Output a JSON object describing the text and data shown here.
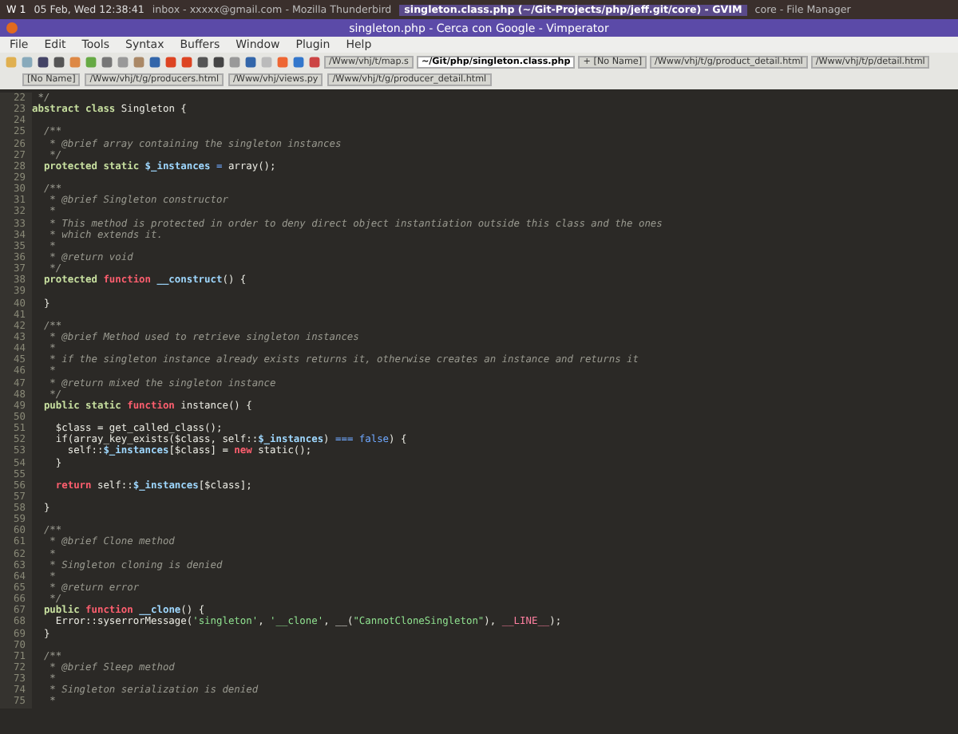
{
  "panel": {
    "workspace": "W 1",
    "clock": "05 Feb, Wed 12:38:41",
    "tasks": [
      {
        "label": "inbox - xxxxx@gmail.com - Mozilla Thunderbird",
        "selected": false
      },
      {
        "label": "singleton.class.php (~/Git-Projects/php/jeff.git/core) - GVIM",
        "selected": true
      },
      {
        "label": "core - File Manager",
        "selected": false
      }
    ]
  },
  "window": {
    "title": "singleton.php - Cerca con Google - Vimperator"
  },
  "menu": [
    "File",
    "Edit",
    "Tools",
    "Syntax",
    "Buffers",
    "Window",
    "Plugin",
    "Help"
  ],
  "buffers_top": [
    {
      "label": "/Www/vhj/t/map.s",
      "selected": false
    },
    {
      "label": "~/Git/php/singleton.class.php",
      "selected": true
    },
    {
      "label": "+ [No Name]",
      "selected": false
    },
    {
      "label": "/Www/vhj/t/g/product_detail.html",
      "selected": false
    },
    {
      "label": "/Www/vhj/t/p/detail.html",
      "selected": false
    }
  ],
  "buffers": [
    {
      "label": "[No Name]",
      "selected": false
    },
    {
      "label": "/Www/vhj/t/g/producers.html",
      "selected": false
    },
    {
      "label": "/Www/vhj/views.py",
      "selected": false
    },
    {
      "label": "/Www/vhj/t/g/producer_detail.html",
      "selected": false
    }
  ],
  "code": [
    {
      "number": "22",
      "tokens": [
        {
          "kind": "comment",
          "text": " */"
        }
      ]
    },
    {
      "number": "23",
      "tokens": [
        {
          "kind": "keyword",
          "text": "abstract class "
        },
        {
          "kind": "plain",
          "text": "Singleton {"
        }
      ]
    },
    {
      "number": "24"
    },
    {
      "number": "25",
      "tokens": [
        {
          "kind": "comment",
          "text": "  /**"
        }
      ]
    },
    {
      "number": "26",
      "tokens": [
        {
          "kind": "comment",
          "text": "   * @brief array containing the singleton instances"
        }
      ]
    },
    {
      "number": "27",
      "tokens": [
        {
          "kind": "comment",
          "text": "   */"
        }
      ]
    },
    {
      "number": "28",
      "tokens": [
        {
          "kind": "keyword",
          "text": "  protected static "
        },
        {
          "kind": "variable",
          "text": "$_instances"
        },
        {
          "kind": "operator",
          "text": " = "
        },
        {
          "kind": "plain",
          "text": "array();"
        }
      ]
    },
    {
      "number": "29"
    },
    {
      "number": "30",
      "tokens": [
        {
          "kind": "comment",
          "text": "  /**"
        }
      ]
    },
    {
      "number": "31",
      "tokens": [
        {
          "kind": "comment",
          "text": "   * @brief Singleton constructor"
        }
      ]
    },
    {
      "number": "32",
      "tokens": [
        {
          "kind": "comment",
          "text": "   *"
        }
      ]
    },
    {
      "number": "33",
      "tokens": [
        {
          "kind": "comment",
          "text": "   * This method is protected in order to deny direct object instantiation outside this class and the ones"
        }
      ]
    },
    {
      "number": "34",
      "tokens": [
        {
          "kind": "comment",
          "text": "   * which extends it."
        }
      ]
    },
    {
      "number": "35",
      "tokens": [
        {
          "kind": "comment",
          "text": "   *"
        }
      ]
    },
    {
      "number": "36",
      "tokens": [
        {
          "kind": "comment",
          "text": "   * @return void"
        }
      ]
    },
    {
      "number": "37",
      "tokens": [
        {
          "kind": "comment",
          "text": "   */"
        }
      ]
    },
    {
      "number": "38",
      "tokens": [
        {
          "kind": "keyword",
          "text": "  protected "
        },
        {
          "kind": "function",
          "text": "function "
        },
        {
          "kind": "variable",
          "text": "__construct"
        },
        {
          "kind": "plain",
          "text": "() {"
        }
      ]
    },
    {
      "number": "39"
    },
    {
      "number": "40",
      "tokens": [
        {
          "kind": "plain",
          "text": "  }"
        }
      ]
    },
    {
      "number": "41"
    },
    {
      "number": "42",
      "tokens": [
        {
          "kind": "comment",
          "text": "  /**"
        }
      ]
    },
    {
      "number": "43",
      "tokens": [
        {
          "kind": "comment",
          "text": "   * @brief Method used to retrieve singleton instances"
        }
      ]
    },
    {
      "number": "44",
      "tokens": [
        {
          "kind": "comment",
          "text": "   *"
        }
      ]
    },
    {
      "number": "45",
      "tokens": [
        {
          "kind": "comment",
          "text": "   * if the singleton instance already exists returns it, otherwise creates an instance and returns it"
        }
      ]
    },
    {
      "number": "46",
      "tokens": [
        {
          "kind": "comment",
          "text": "   *"
        }
      ]
    },
    {
      "number": "47",
      "tokens": [
        {
          "kind": "comment",
          "text": "   * @return mixed the singleton instance"
        }
      ]
    },
    {
      "number": "48",
      "tokens": [
        {
          "kind": "comment",
          "text": "   */"
        }
      ]
    },
    {
      "number": "49",
      "tokens": [
        {
          "kind": "keyword",
          "text": "  public static "
        },
        {
          "kind": "function",
          "text": "function "
        },
        {
          "kind": "plain",
          "text": "instance() {"
        }
      ]
    },
    {
      "number": "50"
    },
    {
      "number": "51",
      "tokens": [
        {
          "kind": "plain",
          "text": "    $class = get_called_class();"
        }
      ]
    },
    {
      "number": "52",
      "tokens": [
        {
          "kind": "plain",
          "text": "    if(array_key_exists($class, self::"
        },
        {
          "kind": "variable",
          "text": "$_instances"
        },
        {
          "kind": "plain",
          "text": ") "
        },
        {
          "kind": "operator",
          "text": "=== false"
        },
        {
          "kind": "plain",
          "text": ") {"
        }
      ]
    },
    {
      "number": "53",
      "tokens": [
        {
          "kind": "plain",
          "text": "      self::"
        },
        {
          "kind": "variable",
          "text": "$_instances"
        },
        {
          "kind": "plain",
          "text": "[$class] = "
        },
        {
          "kind": "function",
          "text": "new "
        },
        {
          "kind": "plain",
          "text": "static();"
        }
      ]
    },
    {
      "number": "54",
      "tokens": [
        {
          "kind": "plain",
          "text": "    }"
        }
      ]
    },
    {
      "number": "55"
    },
    {
      "number": "56",
      "tokens": [
        {
          "kind": "function",
          "text": "    return "
        },
        {
          "kind": "plain",
          "text": "self::"
        },
        {
          "kind": "variable",
          "text": "$_instances"
        },
        {
          "kind": "plain",
          "text": "[$class];"
        }
      ]
    },
    {
      "number": "57"
    },
    {
      "number": "58",
      "tokens": [
        {
          "kind": "plain",
          "text": "  }"
        }
      ]
    },
    {
      "number": "59"
    },
    {
      "number": "60",
      "tokens": [
        {
          "kind": "comment",
          "text": "  /**"
        }
      ]
    },
    {
      "number": "61",
      "tokens": [
        {
          "kind": "comment",
          "text": "   * @brief Clone method"
        }
      ]
    },
    {
      "number": "62",
      "tokens": [
        {
          "kind": "comment",
          "text": "   *"
        }
      ]
    },
    {
      "number": "63",
      "tokens": [
        {
          "kind": "comment",
          "text": "   * Singleton cloning is denied"
        }
      ]
    },
    {
      "number": "64",
      "tokens": [
        {
          "kind": "comment",
          "text": "   *"
        }
      ]
    },
    {
      "number": "65",
      "tokens": [
        {
          "kind": "comment",
          "text": "   * @return error"
        }
      ]
    },
    {
      "number": "66",
      "tokens": [
        {
          "kind": "comment",
          "text": "   */"
        }
      ]
    },
    {
      "number": "67",
      "tokens": [
        {
          "kind": "keyword",
          "text": "  public "
        },
        {
          "kind": "function",
          "text": "function "
        },
        {
          "kind": "variable",
          "text": "__clone"
        },
        {
          "kind": "plain",
          "text": "() {"
        }
      ]
    },
    {
      "number": "68",
      "tokens": [
        {
          "kind": "plain",
          "text": "    Error::syserrorMessage("
        },
        {
          "kind": "string",
          "text": "'singleton'"
        },
        {
          "kind": "plain",
          "text": ", "
        },
        {
          "kind": "string",
          "text": "'__clone'"
        },
        {
          "kind": "plain",
          "text": ", __("
        },
        {
          "kind": "string",
          "text": "\"CannotCloneSingleton\""
        },
        {
          "kind": "plain",
          "text": "), "
        },
        {
          "kind": "constant",
          "text": "__LINE__"
        },
        {
          "kind": "plain",
          "text": ");"
        }
      ]
    },
    {
      "number": "69",
      "tokens": [
        {
          "kind": "plain",
          "text": "  }"
        }
      ]
    },
    {
      "number": "70"
    },
    {
      "number": "71",
      "tokens": [
        {
          "kind": "comment",
          "text": "  /**"
        }
      ]
    },
    {
      "number": "72",
      "tokens": [
        {
          "kind": "comment",
          "text": "   * @brief Sleep method"
        }
      ]
    },
    {
      "number": "73",
      "tokens": [
        {
          "kind": "comment",
          "text": "   *"
        }
      ]
    },
    {
      "number": "74",
      "tokens": [
        {
          "kind": "comment",
          "text": "   * Singleton serialization is denied"
        }
      ]
    },
    {
      "number": "75",
      "tokens": [
        {
          "kind": "comment",
          "text": "   *"
        }
      ]
    }
  ]
}
